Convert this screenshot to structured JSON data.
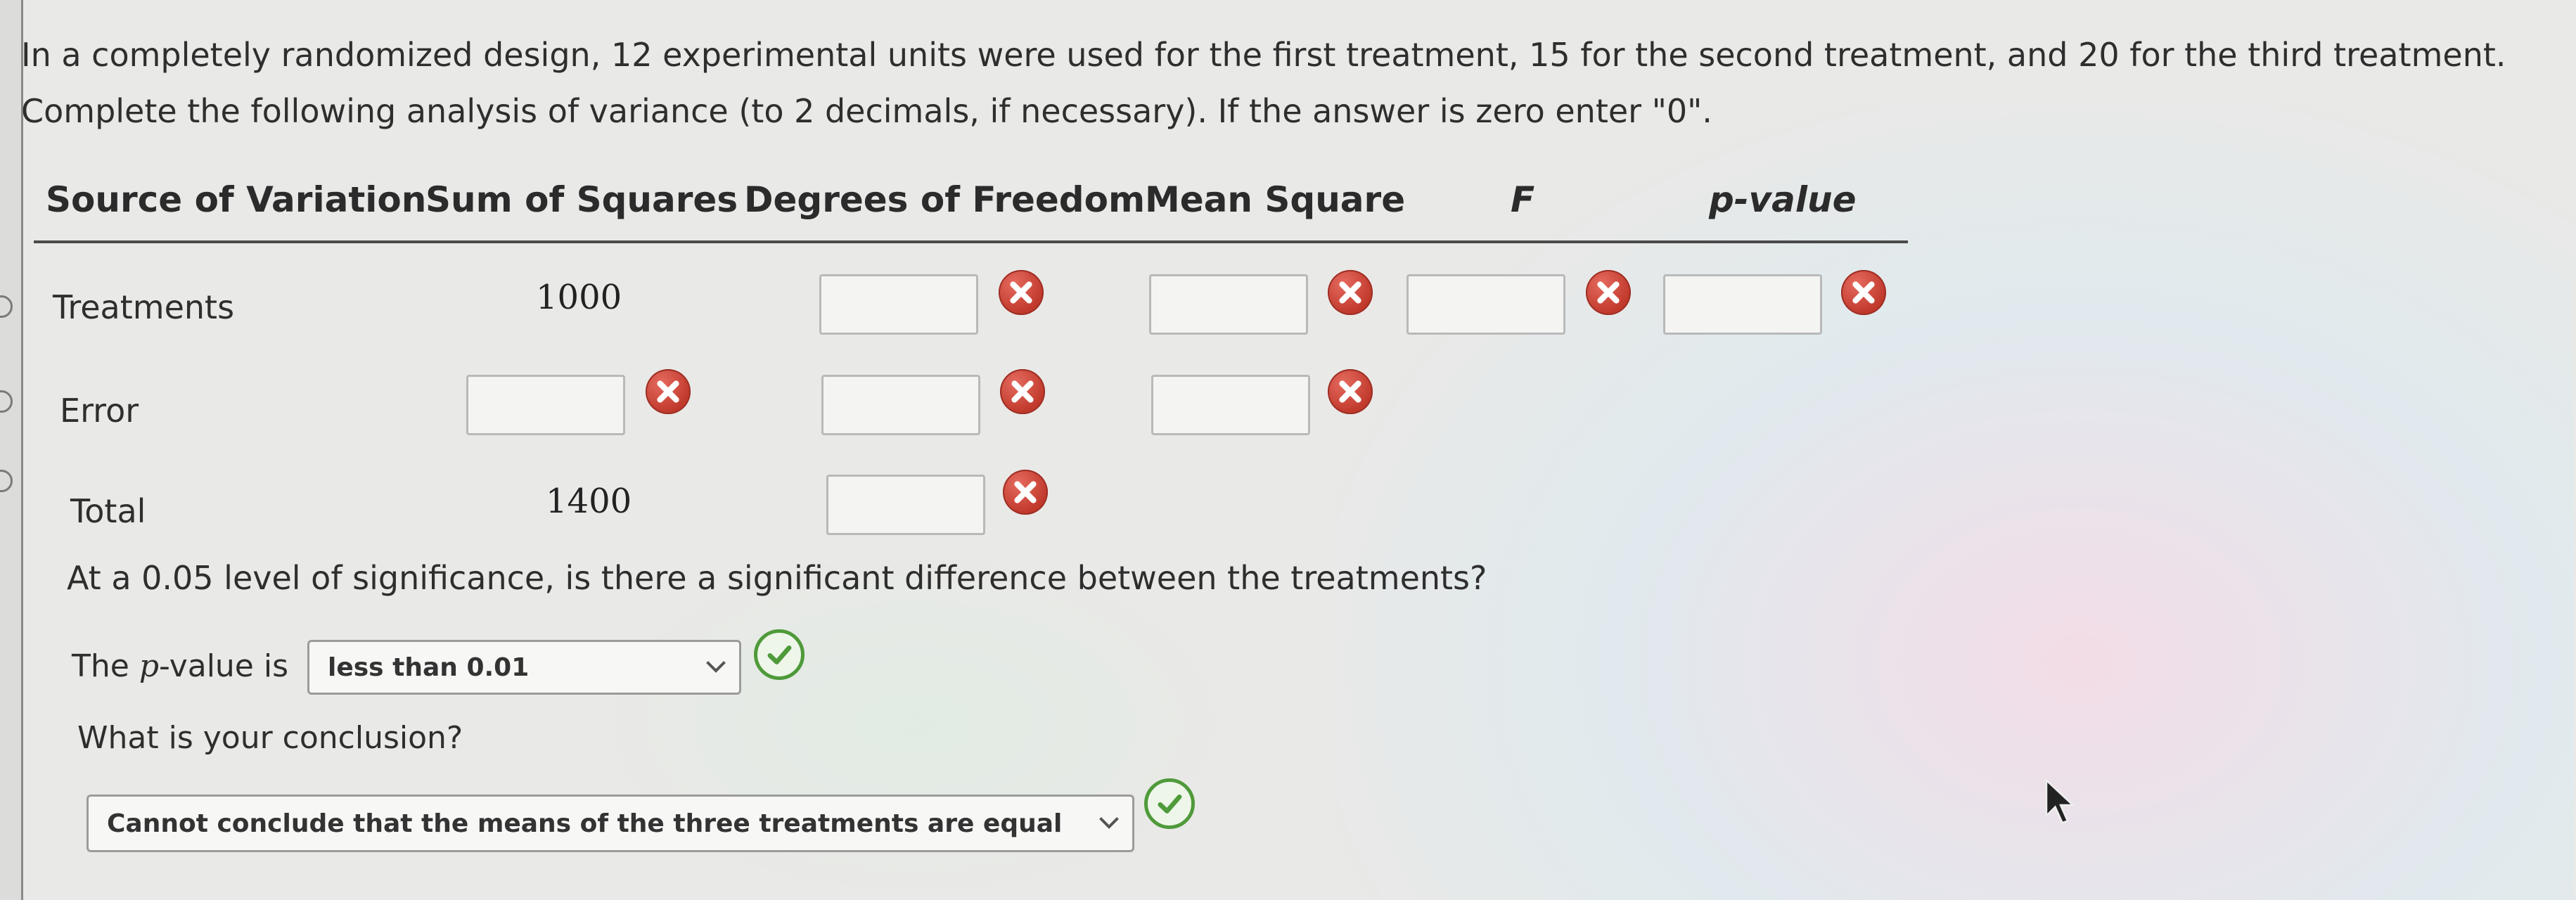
{
  "question": {
    "line1": "In a completely randomized design, 12 experimental units were used for the first treatment, 15 for the second treatment, and 20 for the third treatment.",
    "line2": "Complete the following analysis of variance (to 2 decimals, if necessary). If the answer is zero enter \"0\"."
  },
  "table": {
    "headers": {
      "source": "Source of Variation",
      "ss": "Sum of Squares",
      "df": "Degrees of Freedom",
      "ms": "Mean Square",
      "f": "F",
      "p": "p-value"
    },
    "rows": [
      {
        "label": "Treatments",
        "ss": "1000",
        "df": "",
        "ms": "",
        "f": "",
        "p": ""
      },
      {
        "label": "Error",
        "ss": "",
        "df": "",
        "ms": ""
      },
      {
        "label": "Total",
        "ss": "1400",
        "df": ""
      }
    ]
  },
  "significance_question": "At a 0.05 level of significance, is there a significant difference between the treatments?",
  "pvalue_select": {
    "label_prefix": "The ",
    "label_var": "p",
    "label_suffix": "-value is",
    "selected": "less than 0.01"
  },
  "conclusion": {
    "question": "What is your conclusion?",
    "selected": "Cannot conclude that the means of the three treatments are equal"
  },
  "colors": {
    "incorrect": "#c0392b",
    "correct": "#4f9a3a"
  },
  "icons": {
    "incorrect": "x-icon",
    "correct": "check-icon",
    "dropdown": "chevron-down-icon"
  }
}
